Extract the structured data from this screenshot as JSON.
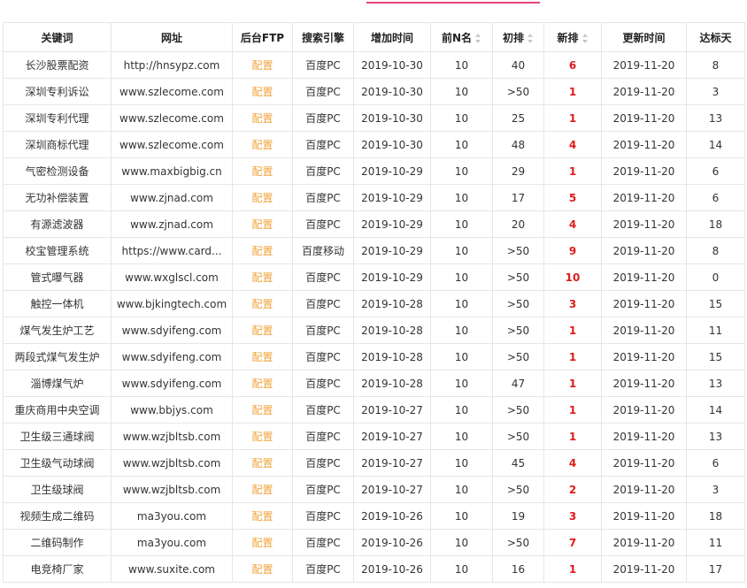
{
  "table": {
    "headers": [
      "关键词",
      "网址",
      "后台FTP",
      "搜索引擎",
      "增加时间",
      "前N名",
      "初排",
      "新排",
      "更新时间",
      "达标天"
    ],
    "rows": [
      [
        "长沙股票配资",
        "http://hnsypz.com",
        "配置",
        "百度PC",
        "2019-10-30",
        "10",
        "40",
        "6",
        "2019-11-20",
        "8"
      ],
      [
        "深圳专利诉讼",
        "www.szlecome.com",
        "配置",
        "百度PC",
        "2019-10-30",
        "10",
        ">50",
        "1",
        "2019-11-20",
        "3"
      ],
      [
        "深圳专利代理",
        "www.szlecome.com",
        "配置",
        "百度PC",
        "2019-10-30",
        "10",
        "25",
        "1",
        "2019-11-20",
        "13"
      ],
      [
        "深圳商标代理",
        "www.szlecome.com",
        "配置",
        "百度PC",
        "2019-10-30",
        "10",
        "48",
        "4",
        "2019-11-20",
        "14"
      ],
      [
        "气密检测设备",
        "www.maxbigbig.cn",
        "配置",
        "百度PC",
        "2019-10-29",
        "10",
        "29",
        "1",
        "2019-11-20",
        "6"
      ],
      [
        "无功补偿装置",
        "www.zjnad.com",
        "配置",
        "百度PC",
        "2019-10-29",
        "10",
        "17",
        "5",
        "2019-11-20",
        "6"
      ],
      [
        "有源滤波器",
        "www.zjnad.com",
        "配置",
        "百度PC",
        "2019-10-29",
        "10",
        "20",
        "4",
        "2019-11-20",
        "18"
      ],
      [
        "校宝管理系统",
        "https://www.card...",
        "配置",
        "百度移动",
        "2019-10-29",
        "10",
        ">50",
        "9",
        "2019-11-20",
        "8"
      ],
      [
        "管式曝气器",
        "www.wxglscl.com",
        "配置",
        "百度PC",
        "2019-10-29",
        "10",
        ">50",
        "10",
        "2019-11-20",
        "0"
      ],
      [
        "触控一体机",
        "www.bjkingtech.com",
        "配置",
        "百度PC",
        "2019-10-28",
        "10",
        ">50",
        "3",
        "2019-11-20",
        "15"
      ],
      [
        "煤气发生炉工艺",
        "www.sdyifeng.com",
        "配置",
        "百度PC",
        "2019-10-28",
        "10",
        ">50",
        "1",
        "2019-11-20",
        "11"
      ],
      [
        "两段式煤气发生炉",
        "www.sdyifeng.com",
        "配置",
        "百度PC",
        "2019-10-28",
        "10",
        ">50",
        "1",
        "2019-11-20",
        "15"
      ],
      [
        "淄博煤气炉",
        "www.sdyifeng.com",
        "配置",
        "百度PC",
        "2019-10-28",
        "10",
        "47",
        "1",
        "2019-11-20",
        "13"
      ],
      [
        "重庆商用中央空调",
        "www.bbjys.com",
        "配置",
        "百度PC",
        "2019-10-27",
        "10",
        ">50",
        "1",
        "2019-11-20",
        "14"
      ],
      [
        "卫生级三通球阀",
        "www.wzjbltsb.com",
        "配置",
        "百度PC",
        "2019-10-27",
        "10",
        ">50",
        "1",
        "2019-11-20",
        "13"
      ],
      [
        "卫生级气动球阀",
        "www.wzjbltsb.com",
        "配置",
        "百度PC",
        "2019-10-27",
        "10",
        "45",
        "4",
        "2019-11-20",
        "6"
      ],
      [
        "卫生级球阀",
        "www.wzjbltsb.com",
        "配置",
        "百度PC",
        "2019-10-27",
        "10",
        ">50",
        "2",
        "2019-11-20",
        "3"
      ],
      [
        "视频生成二维码",
        "ma3you.com",
        "配置",
        "百度PC",
        "2019-10-26",
        "10",
        "19",
        "3",
        "2019-11-20",
        "18"
      ],
      [
        "二维码制作",
        "ma3you.com",
        "配置",
        "百度PC",
        "2019-10-26",
        "10",
        ">50",
        "7",
        "2019-11-20",
        "11"
      ],
      [
        "电竞椅厂家",
        "www.suxite.com",
        "配置",
        "百度PC",
        "2019-10-26",
        "10",
        "16",
        "1",
        "2019-11-20",
        "17"
      ]
    ]
  },
  "colors": {
    "accent": "#e8417c",
    "config_link": "#f0a33a",
    "new_rank": "#e01b1b"
  }
}
